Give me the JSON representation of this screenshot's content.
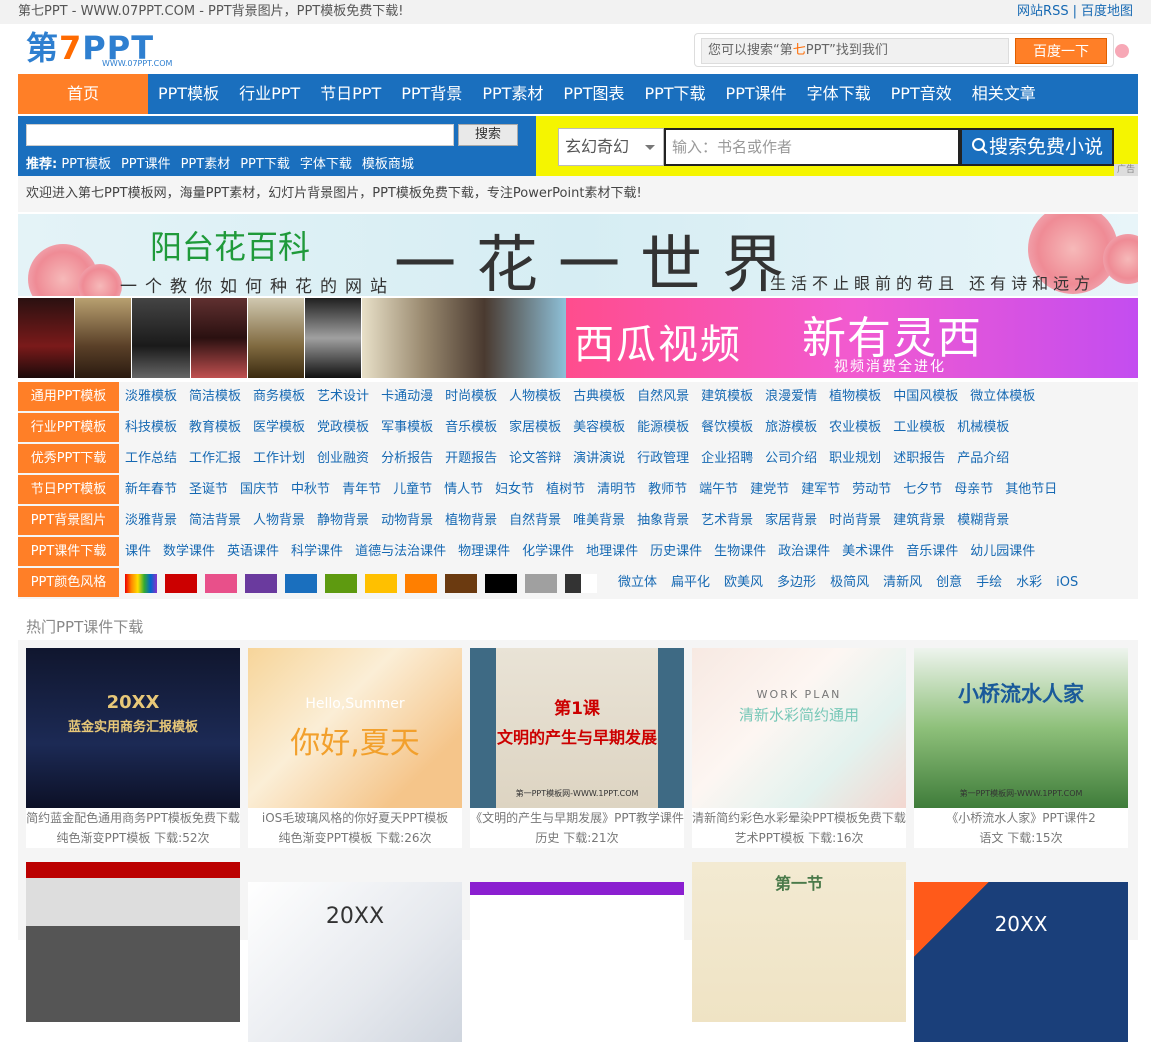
{
  "topbar": {
    "site_title": "第七PPT - WWW.07PPT.COM - PPT背景图片，PPT模板免费下载!",
    "link_rss": "网站RSS",
    "separator": "|",
    "link_sitemap": "百度地图"
  },
  "logo": {
    "text_prefix": "第",
    "text_seven": "7",
    "text_suffix": "PPT",
    "url": "WWW.07PPT.COM"
  },
  "header_search": {
    "placeholder_prefix": "您可以搜索“第",
    "placeholder_highlight": "七",
    "placeholder_suffix": "PPT”找到我们",
    "button": "百度一下"
  },
  "nav": {
    "home": "首页",
    "items": [
      "PPT模板",
      "行业PPT",
      "节日PPT",
      "PPT背景",
      "PPT素材",
      "PPT图表",
      "PPT下载",
      "PPT课件",
      "字体下载",
      "PPT音效",
      "相关文章"
    ]
  },
  "site_search": {
    "button": "搜索",
    "recommend_label": "推荐:",
    "recommend": [
      "PPT模板",
      "PPT课件",
      "PPT素材",
      "PPT下载",
      "字体下载",
      "模板商城"
    ]
  },
  "novel_search": {
    "category": "玄幻奇幻",
    "placeholder": "输入：书名或作者",
    "button": "搜索免费小说",
    "ad_tag": "广告"
  },
  "welcome": "欢迎进入第七PPT模板网，海量PPT素材，幻灯片背景图片，PPT模板免费下载，专注PowerPoint素材下载!",
  "banner_flower": {
    "title": "阳台花百科",
    "subtitle": "一个教你如何种花的网站",
    "slogan": "一花一世界",
    "tagline": "生活不止眼前的苟且  还有诗和远方"
  },
  "banner_video": {
    "brand": "西瓜视频",
    "headline": "新有灵西",
    "sub": "视频消费全进化"
  },
  "categories": [
    {
      "label": "通用PPT模板",
      "links": [
        "淡雅模板",
        "简洁模板",
        "商务模板",
        "艺术设计",
        "卡通动漫",
        "时尚模板",
        "人物模板",
        "古典模板",
        "自然风景",
        "建筑模板",
        "浪漫爱情",
        "植物模板",
        "中国风模板",
        "微立体模板"
      ]
    },
    {
      "label": "行业PPT模板",
      "links": [
        "科技模板",
        "教育模板",
        "医学模板",
        "党政模板",
        "军事模板",
        "音乐模板",
        "家居模板",
        "美容模板",
        "能源模板",
        "餐饮模板",
        "旅游模板",
        "农业模板",
        "工业模板",
        "机械模板"
      ]
    },
    {
      "label": "优秀PPT下载",
      "links": [
        "工作总结",
        "工作汇报",
        "工作计划",
        "创业融资",
        "分析报告",
        "开题报告",
        "论文答辩",
        "演讲演说",
        "行政管理",
        "企业招聘",
        "公司介绍",
        "职业规划",
        "述职报告",
        "产品介绍"
      ]
    },
    {
      "label": "节日PPT模板",
      "links": [
        "新年春节",
        "圣诞节",
        "国庆节",
        "中秋节",
        "青年节",
        "儿童节",
        "情人节",
        "妇女节",
        "植树节",
        "清明节",
        "教师节",
        "端午节",
        "建党节",
        "建军节",
        "劳动节",
        "七夕节",
        "母亲节",
        "其他节日"
      ]
    },
    {
      "label": "PPT背景图片",
      "links": [
        "淡雅背景",
        "简洁背景",
        "人物背景",
        "静物背景",
        "动物背景",
        "植物背景",
        "自然背景",
        "唯美背景",
        "抽象背景",
        "艺术背景",
        "家居背景",
        "时尚背景",
        "建筑背景",
        "模糊背景"
      ]
    },
    {
      "label": "PPT课件下载",
      "links": [
        "课件",
        "数学课件",
        "英语课件",
        "科学课件",
        "道德与法治课件",
        "物理课件",
        "化学课件",
        "地理课件",
        "历史课件",
        "生物课件",
        "政治课件",
        "美术课件",
        "音乐课件",
        "幼儿园课件"
      ]
    }
  ],
  "colors_row": {
    "label": "PPT颜色风格",
    "swatches": [
      "rainbow",
      "#cc0000",
      "#e8508a",
      "#6a3a9e",
      "#1a6fbe",
      "#5e9a10",
      "#ffc000",
      "#ff7f00",
      "#6b3a10",
      "#000000",
      "#a0a0a0",
      "bw"
    ],
    "styles": [
      "微立体",
      "扁平化",
      "欧美风",
      "多边形",
      "极简风",
      "清新风",
      "创意",
      "手绘",
      "水彩",
      "iOS"
    ]
  },
  "hot": {
    "title": "热门PPT课件下载",
    "download_label": "下载:",
    "cards": [
      {
        "caption": "简约蓝金配色通用商务PPT模板免费下载",
        "category": "纯色渐变PPT模板",
        "downloads": "52次",
        "img_line1": "20XX",
        "img_line2": "蓝金实用商务汇报模板"
      },
      {
        "caption": "iOS毛玻璃风格的你好夏天PPT模板",
        "category": "纯色渐变PPT模板",
        "downloads": "26次",
        "img_line1": "Hello,Summer",
        "img_line2": "你好,夏天"
      },
      {
        "caption": "《文明的产生与早期发展》PPT教学课件",
        "category": "历史",
        "downloads": "21次",
        "img_line1": "第1课",
        "img_line2": "文明的产生与早期发展",
        "img_line3": "第一PPT模板网-WWW.1PPT.COM"
      },
      {
        "caption": "清新简约彩色水彩晕染PPT模板免费下载",
        "category": "艺术PPT模板",
        "downloads": "16次",
        "img_line1": "WORK PLAN",
        "img_line2": "清新水彩简约通用"
      },
      {
        "caption": "《小桥流水人家》PPT课件2",
        "category": "语文",
        "downloads": "15次",
        "img_line1": "小桥流水人家",
        "img_line2": "第一PPT模板网-WWW.1PPT.COM"
      }
    ],
    "row2": [
      {
        "img_line1": ""
      },
      {
        "img_line1": "20XX"
      },
      {
        "img_line1": ""
      },
      {
        "img_line1": "第一节"
      },
      {
        "img_line1": "20XX"
      }
    ]
  }
}
